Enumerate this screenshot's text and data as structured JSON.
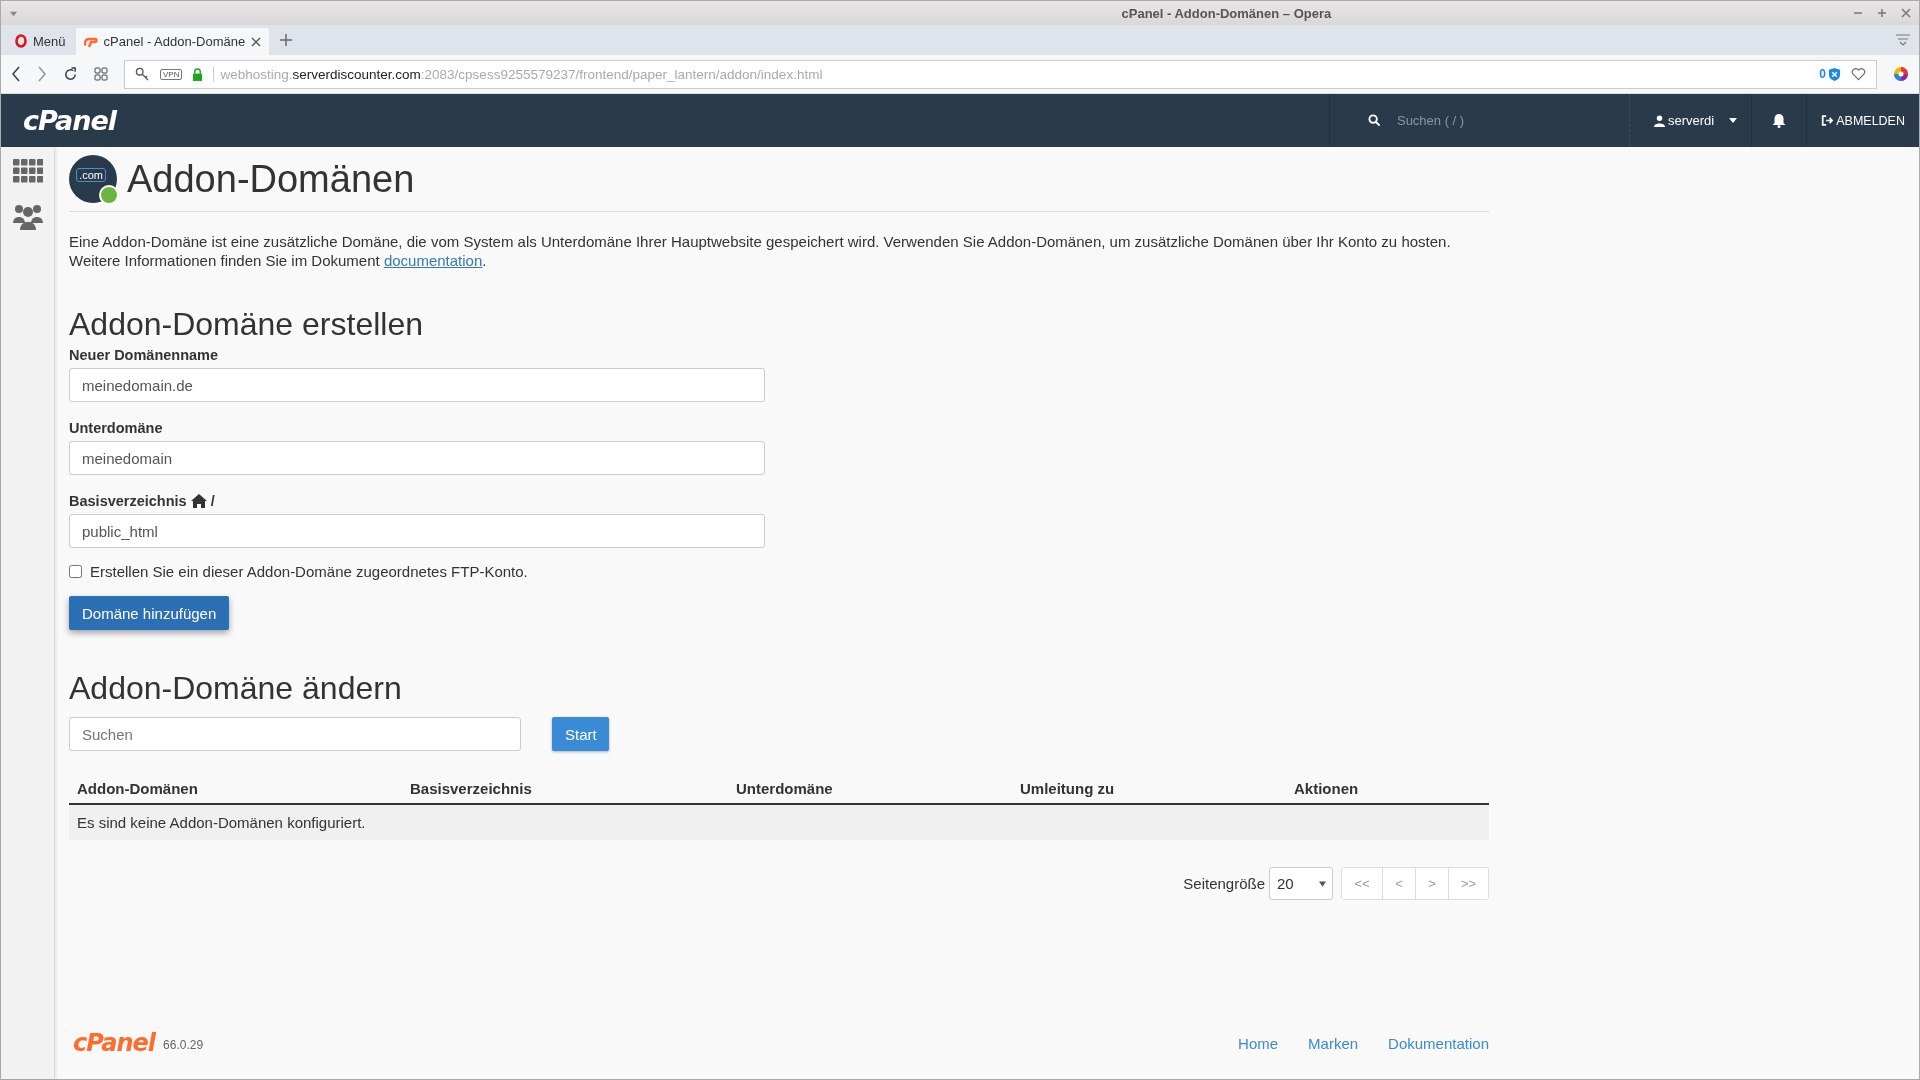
{
  "window": {
    "title": "cPanel - Addon-Domänen – Opera"
  },
  "browser": {
    "menu_label": "Menü",
    "tabs": [
      {
        "label": "cPanel - Addon-Domäne",
        "selected": true
      }
    ],
    "address": {
      "prefix": "webhosting.",
      "host": "serverdiscounter.com",
      "path": ":2083/cpsess9255579237/frontend/paper_lantern/addon/index.html"
    },
    "vpn_label": "VPN",
    "blocked_count": "0"
  },
  "header": {
    "logo": "cPanel",
    "search_placeholder": "Suchen ( / )",
    "user": "serverdi",
    "logout": "ABMELDEN"
  },
  "page": {
    "title": "Addon-Domänen",
    "icon_label": ".com",
    "intro": {
      "text": "Eine Addon-Domäne ist eine zusätzliche Domäne, die vom System als Unterdomäne Ihrer Hauptwebsite gespeichert wird. Verwenden Sie Addon-Domänen, um zusätzliche Domänen über Ihr Konto zu hosten. Weitere Informationen finden Sie im Dokument",
      "link": "documentation",
      "end": "."
    },
    "create": {
      "heading": "Addon-Domäne erstellen",
      "fields": [
        {
          "kind": "plain",
          "label": "Neuer Domänenname",
          "value": "meinedomain.de"
        },
        {
          "kind": "plain",
          "label": "Unterdomäne",
          "value": "meinedomain"
        },
        {
          "kind": "home",
          "label": "Basisverzeichnis",
          "suffix": "/",
          "value": "public_html"
        }
      ],
      "ftp": {
        "label": "Erstellen Sie ein dieser Addon-Domäne zugeordnetes FTP-Konto.",
        "checked": false
      },
      "button": "Domäne hinzufügen"
    },
    "manage": {
      "heading": "Addon-Domäne ändern",
      "search_placeholder": "Suchen",
      "search_button": "Start",
      "table": {
        "columns": [
          "Addon-Domänen",
          "Basisverzeichnis",
          "Unterdomäne",
          "Umleitung zu",
          "Aktionen"
        ],
        "empty": "Es sind keine Addon-Domänen konfiguriert."
      },
      "pager": {
        "size_label": "Seitengröße",
        "size": "20",
        "buttons": [
          "<<",
          "<",
          ">",
          ">>"
        ]
      }
    }
  },
  "footer": {
    "logo": "cPanel",
    "version": "66.0.29",
    "links": [
      "Home",
      "Marken",
      "Dokumentation"
    ]
  }
}
